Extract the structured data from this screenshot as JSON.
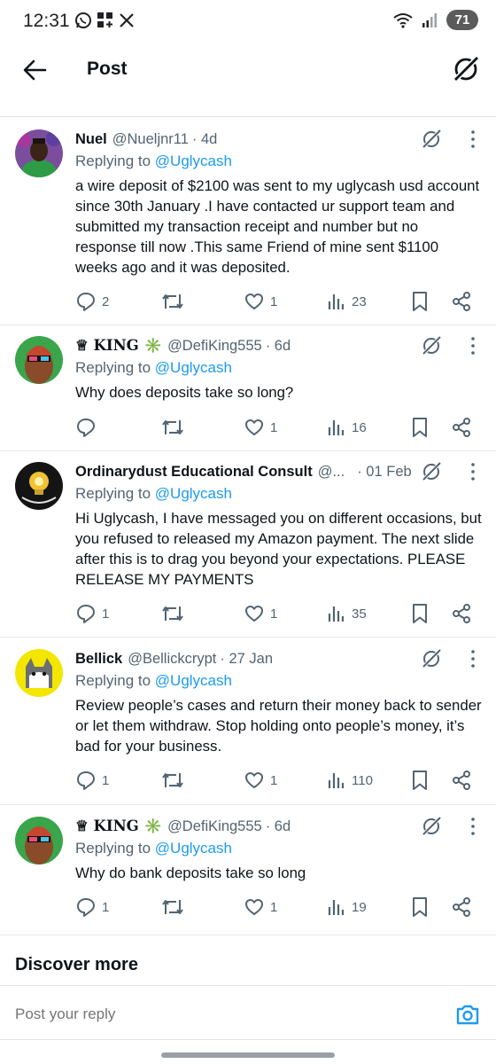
{
  "status_bar": {
    "time": "12:31",
    "battery": "71"
  },
  "header": {
    "title": "Post"
  },
  "tweets": [
    {
      "name": "Nuel",
      "handle": "@Nueljnr11",
      "time": "· 4d",
      "replying_prefix": "Replying to ",
      "replying_to": "@Uglycash",
      "text": "a wire deposit of $2100  was sent  to my uglycash usd account since 30th January .I have contacted ur support team  and submitted my transaction receipt and number but no response till now .This same Friend of mine sent $1100 weeks ago and it was deposited.",
      "replies": "2",
      "retweets": "",
      "likes": "1",
      "views": "23"
    },
    {
      "name": "♕ KING ✳️",
      "handle": "@DefiKing555",
      "time": "· 6d",
      "replying_prefix": "Replying to ",
      "replying_to": "@Uglycash",
      "text": "Why does deposits take so long?",
      "replies": "",
      "retweets": "",
      "likes": "1",
      "views": "16"
    },
    {
      "name": "Ordinarydust Educational Consult",
      "handle": "@...",
      "time": "· 01 Feb",
      "replying_prefix": "Replying to ",
      "replying_to": "@Uglycash",
      "text": "Hi Uglycash, I have messaged you on different occasions, but you refused to released my Amazon payment. The next slide after this is to drag you beyond your expectations. PLEASE RELEASE MY PAYMENTS",
      "replies": "1",
      "retweets": "",
      "likes": "1",
      "views": "35"
    },
    {
      "name": "Bellick",
      "handle": "@Bellickcrypt",
      "time": "· 27 Jan",
      "replying_prefix": "Replying to ",
      "replying_to": "@Uglycash",
      "text": "Review people’s cases and return their money back to sender or let them withdraw. Stop holding onto people’s money, it’s bad for your business.",
      "replies": "1",
      "retweets": "",
      "likes": "1",
      "views": "110"
    },
    {
      "name": "♕ KING ✳️",
      "handle": "@DefiKing555",
      "time": "· 6d",
      "replying_prefix": "Replying to ",
      "replying_to": "@Uglycash",
      "text": "Why do bank deposits take so long",
      "replies": "1",
      "retweets": "",
      "likes": "1",
      "views": "19"
    }
  ],
  "discover": {
    "title": "Discover more"
  },
  "reply_bar": {
    "placeholder": "Post your reply"
  },
  "colors": {
    "link": "#1d9bf0",
    "muted": "#536471",
    "text": "#0f1419",
    "divider": "#e6e9ec"
  }
}
